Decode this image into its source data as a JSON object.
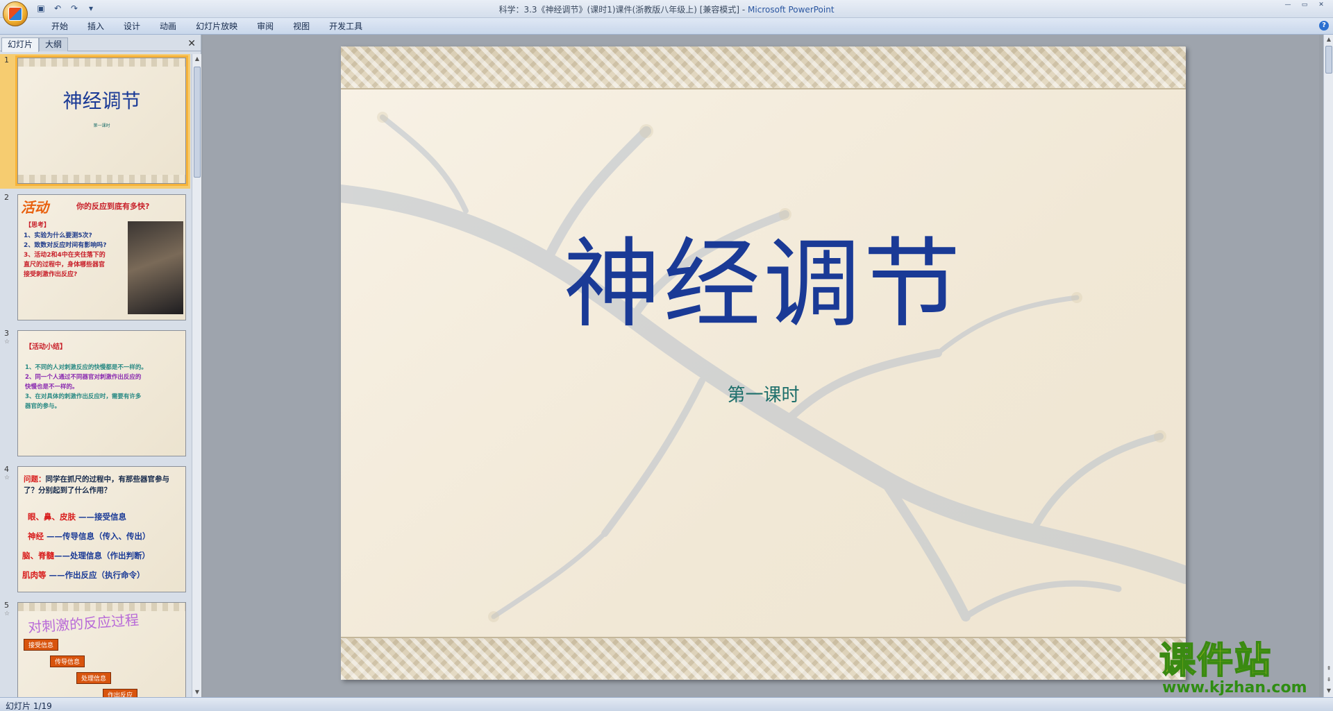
{
  "window": {
    "title": "科学：3.3《神经调节》(课时1)课件(浙教版八年级上) [兼容模式] - ",
    "app_name": "Microsoft PowerPoint"
  },
  "quick_access": {
    "save_icon": "save-icon",
    "undo_icon": "undo-icon",
    "redo_icon": "redo-icon",
    "customize_icon": "dropdown-icon"
  },
  "ribbon": {
    "tabs": [
      "开始",
      "插入",
      "设计",
      "动画",
      "幻灯片放映",
      "审阅",
      "视图",
      "开发工具"
    ]
  },
  "left_panel": {
    "tabs": [
      "幻灯片",
      "大纲"
    ],
    "active_tab": "幻灯片",
    "thumbnails": [
      {
        "number": "1",
        "title": "神经调节",
        "subtitle": "第一课时"
      },
      {
        "number": "2",
        "badge": "活动",
        "heading": "你的反应到底有多快?",
        "think": "【思考】",
        "lines": [
          "1、实验为什么要测5次?",
          "2、致数对反应时间有影响吗?",
          "3、活动2和4中在夹住落下的",
          "直尺的过程中，身体哪些器官",
          "接受刺激作出反应?"
        ]
      },
      {
        "number": "3",
        "heading": "【活动小结】",
        "lines": [
          "1、不同的人对刺激反应的快慢都是不一样的。",
          "2、同一个人通过不同器官对刺激作出反应的",
          "快慢也是不一样的。",
          "3、在对具体的刺激作出反应时，需要有许多",
          "器官的参与。"
        ]
      },
      {
        "number": "4",
        "q_label": "问题：",
        "question": "同学在抓尺的过程中，有那些器官参与了？分别起到了什么作用？",
        "items": [
          {
            "organ": "眼、鼻、皮肤",
            "role": "——接受信息"
          },
          {
            "organ": "神经",
            "role": "——传导信息（传入、传出）"
          },
          {
            "organ": "脑、脊髓",
            "role": "——处理信息（作出判断）"
          },
          {
            "organ": "肌肉等",
            "role": "——作出反应（执行命令）"
          }
        ]
      },
      {
        "number": "5",
        "heading": "对刺激的反应过程",
        "steps": [
          "接受信息",
          "传导信息",
          "处理信息",
          "作出反应"
        ]
      }
    ]
  },
  "slide": {
    "title": "神经调节",
    "subtitle": "第一课时"
  },
  "watermark": {
    "logo": "课件站",
    "url": "www.kjzhan.com"
  },
  "status": {
    "slide_indicator": "幻灯片 1/19"
  },
  "colors": {
    "title_blue": "#1a3a96",
    "subtitle_teal": "#1c6e6a",
    "selected_outline": "#f6b33a"
  }
}
